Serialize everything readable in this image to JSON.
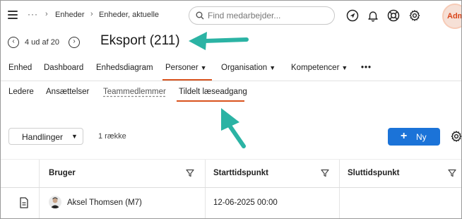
{
  "topbar": {
    "breadcrumbs": [
      "Enheder",
      "Enheder, aktuelle"
    ],
    "search_placeholder": "Find medarbejder...",
    "icons": [
      "menu-icon",
      "navigation-icon",
      "bell-icon",
      "help-lifebuoy-icon",
      "gear-icon"
    ],
    "user_initials": "Adm",
    "avatar_color": "#d9451b"
  },
  "header": {
    "pager_text": "4 ud af 20",
    "title": "Eksport (211)"
  },
  "main_nav": {
    "items": [
      {
        "label": "Enhed",
        "dropdown": false
      },
      {
        "label": "Dashboard",
        "dropdown": false
      },
      {
        "label": "Enhedsdiagram",
        "dropdown": false
      },
      {
        "label": "Personer",
        "dropdown": true,
        "active": true
      },
      {
        "label": "Organisation",
        "dropdown": true
      },
      {
        "label": "Kompetencer",
        "dropdown": true
      }
    ],
    "more": "•••"
  },
  "sub_nav": {
    "items": [
      {
        "label": "Ledere"
      },
      {
        "label": "Ansættelser"
      },
      {
        "label": "Teammedlemmer"
      },
      {
        "label": "Tildelt læseadgang",
        "active": true
      }
    ]
  },
  "toolbar": {
    "actions_label": "Handlinger",
    "row_count": "1 række",
    "new_label": "Ny",
    "accent_color": "#1b73d8",
    "active_tab_color": "#d9531e"
  },
  "table": {
    "columns": [
      "Bruger",
      "Starttidspunkt",
      "Sluttidspunkt"
    ],
    "rows": [
      {
        "user": "Aksel Thomsen (M7)",
        "start": "12-06-2025 00:00",
        "end": ""
      }
    ]
  },
  "annotation_color": "#2bb3a4"
}
